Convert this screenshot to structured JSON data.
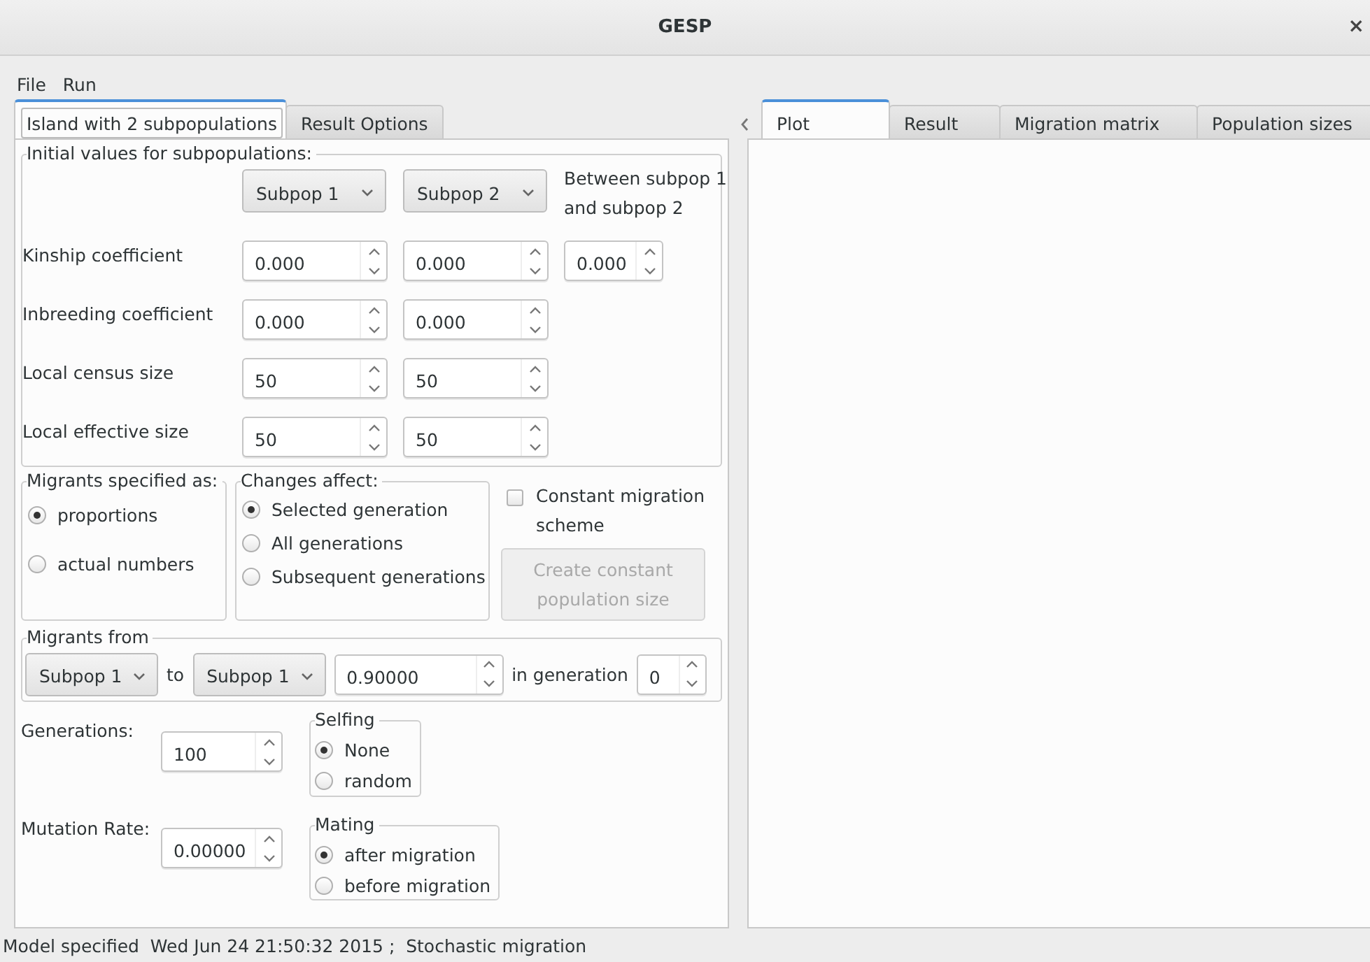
{
  "window": {
    "title": "GESP",
    "close": "×"
  },
  "menu": [
    "File",
    "Run"
  ],
  "left_tabs": [
    {
      "label": "Island with 2 subpopulations",
      "selected": true
    },
    {
      "label": "Result Options",
      "selected": false
    }
  ],
  "initial_values": {
    "legend": "Initial values for subpopulations:",
    "columns": [
      {
        "kind": "combo",
        "label": "Subpop 1"
      },
      {
        "kind": "combo",
        "label": "Subpop 2"
      },
      {
        "kind": "text",
        "label": "Between subpop 1 and subpop 2"
      }
    ],
    "rows": [
      {
        "label": "Kinship coefficient",
        "values": [
          "0.000",
          "0.000",
          "0.000"
        ]
      },
      {
        "label": "Inbreeding coefficient",
        "values": [
          "0.000",
          "0.000"
        ]
      },
      {
        "label": "Local census size",
        "values": [
          "50",
          "50"
        ]
      },
      {
        "label": "Local effective size",
        "values": [
          "50",
          "50"
        ]
      }
    ]
  },
  "migrants_specified": {
    "legend": "Migrants specified as:",
    "options": [
      {
        "label": "proportions",
        "selected": true
      },
      {
        "label": "actual numbers",
        "selected": false
      }
    ]
  },
  "changes_affect": {
    "legend": "Changes affect:",
    "options": [
      {
        "label": "Selected generation",
        "selected": true
      },
      {
        "label": "All generations",
        "selected": false
      },
      {
        "label": "Subsequent generations",
        "selected": false
      }
    ]
  },
  "constant_migration": {
    "label": "Constant migration scheme",
    "checked": false
  },
  "create_button": {
    "label": "Create constant population size",
    "disabled": true
  },
  "migrants_from": {
    "legend": "Migrants from",
    "from": "Subpop 1",
    "to_label": "to",
    "to": "Subpop 1",
    "value": "0.90000",
    "generation_label": "in generation",
    "generation": "0"
  },
  "generations": {
    "label": "Generations:",
    "value": "100"
  },
  "selfing": {
    "legend": "Selfing",
    "options": [
      {
        "label": "None",
        "selected": true
      },
      {
        "label": "random",
        "selected": false
      }
    ]
  },
  "mutation_rate": {
    "label": "Mutation Rate:",
    "value": "0.00000"
  },
  "mating": {
    "legend": "Mating",
    "options": [
      {
        "label": "after migration",
        "selected": true
      },
      {
        "label": "before migration",
        "selected": false
      }
    ]
  },
  "right_tabs": [
    {
      "label": "Plot",
      "selected": true
    },
    {
      "label": "Result",
      "selected": false
    },
    {
      "label": "Migration matrix",
      "selected": false
    },
    {
      "label": "Population sizes",
      "selected": false
    }
  ],
  "status_bar": "Model specified  Wed Jun 24 21:50:32 2015 ;  Stochastic migration"
}
